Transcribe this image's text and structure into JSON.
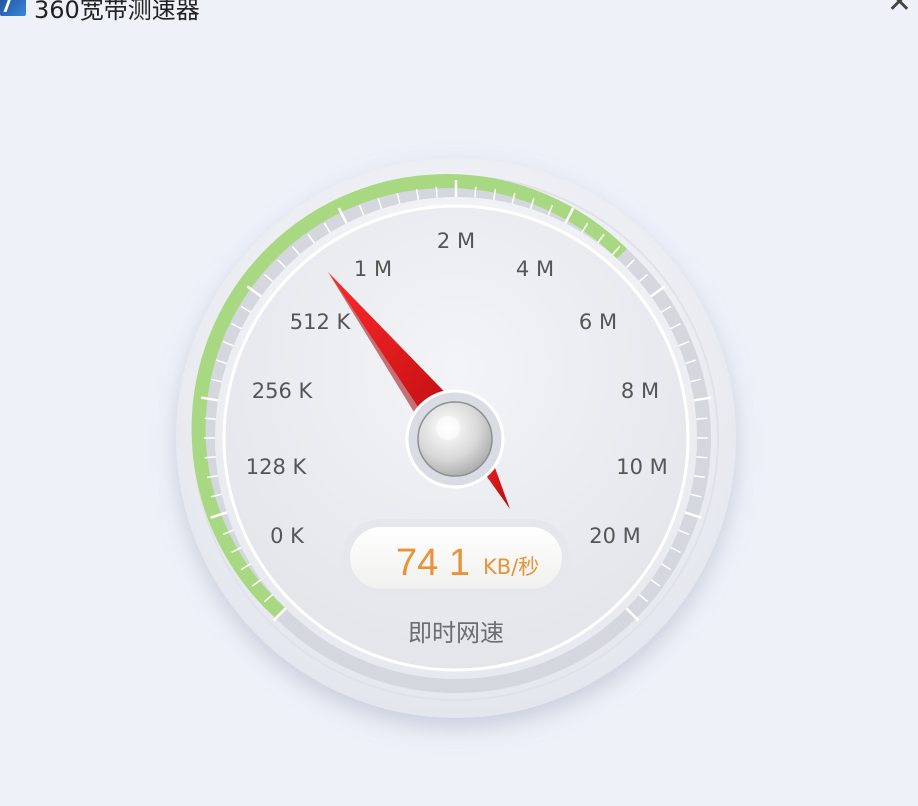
{
  "window": {
    "title": "360宽带测速器",
    "close_glyph": "✕",
    "icon": "app-icon"
  },
  "gauge": {
    "scale_labels": [
      "0 K",
      "128 K",
      "256 K",
      "512 K",
      "1 M",
      "2 M",
      "4 M",
      "6 M",
      "8 M",
      "10 M",
      "20 M"
    ],
    "speed_value": "74 1",
    "speed_unit": "KB/秒",
    "caption": "即时网速",
    "colors": {
      "progress_arc": "#a8d882",
      "needle": "#d10f14",
      "speed_value": "#e8923a",
      "labels": "#555555"
    }
  }
}
